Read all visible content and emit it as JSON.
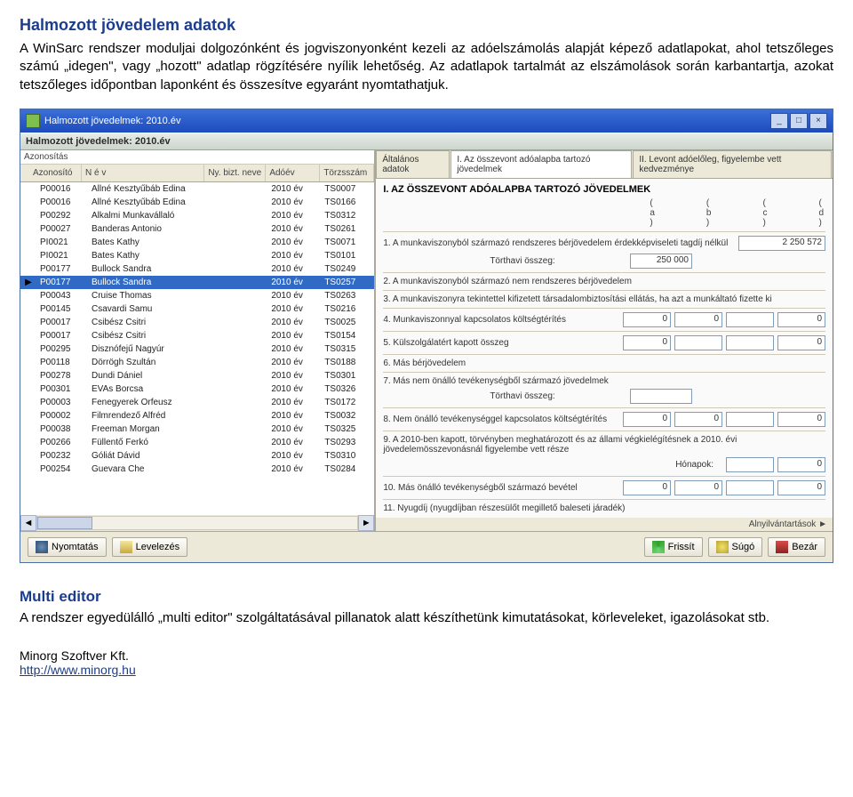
{
  "doc": {
    "heading": "Halmozott jövedelem adatok",
    "para": "A WinSarc rendszer moduljai dolgozónként és jogviszonyonként kezeli az adóelszámolás alapját képező adatlapokat, ahol tetszőleges számú „idegen\", vagy „hozott\" adatlap rögzítésére nyílik lehetőség. Az adatlapok tartalmát az elszámolások során karbantartja, azokat tetszőleges időpontban laponként és összesítve egyaránt nyomtathatjuk.",
    "sub": "Multi editor",
    "subpara": "A rendszer egyedülálló „multi editor\" szolgáltatásával pillanatok alatt készíthetünk kimutatásokat, körleveleket, igazolásokat stb.",
    "company": "Minorg Szoftver Kft.",
    "link": "http://www.minorg.hu"
  },
  "win": {
    "title": "Halmozott jövedelmek: 2010.év",
    "subtitle": "Halmozott jövedelmek: 2010.év"
  },
  "grid": {
    "h_id": "Azonosító",
    "h_name": "N é v",
    "h_biz": "Ny. bizt. neve",
    "h_year": "Adóév",
    "h_ts": "Törzsszám",
    "rows": [
      {
        "id": "P00016",
        "name": "Allné Kesztyűbáb Edina",
        "year": "2010 év",
        "ts": "TS0007"
      },
      {
        "id": "P00016",
        "name": "Allné Kesztyűbáb Edina",
        "year": "2010 év",
        "ts": "TS0166"
      },
      {
        "id": "P00292",
        "name": "Alkalmi Munkavállaló",
        "year": "2010 év",
        "ts": "TS0312"
      },
      {
        "id": "P00027",
        "name": "Banderas Antonio",
        "year": "2010 év",
        "ts": "TS0261"
      },
      {
        "id": "PI0021",
        "name": "Bates Kathy",
        "year": "2010 év",
        "ts": "TS0071"
      },
      {
        "id": "PI0021",
        "name": "Bates Kathy",
        "year": "2010 év",
        "ts": "TS0101"
      },
      {
        "id": "P00177",
        "name": "Bullock Sandra",
        "year": "2010 év",
        "ts": "TS0249"
      },
      {
        "id": "P00177",
        "name": "Bullock Sandra",
        "year": "2010 év",
        "ts": "TS0257",
        "sel": true
      },
      {
        "id": "P00043",
        "name": "Cruise Thomas",
        "year": "2010 év",
        "ts": "TS0263"
      },
      {
        "id": "P00145",
        "name": "Csavardi Samu",
        "year": "2010 év",
        "ts": "TS0216"
      },
      {
        "id": "P00017",
        "name": "Csibész Csitri",
        "year": "2010 év",
        "ts": "TS0025"
      },
      {
        "id": "P00017",
        "name": "Csibész Csitri",
        "year": "2010 év",
        "ts": "TS0154"
      },
      {
        "id": "P00295",
        "name": "Disznófejű Nagyúr",
        "year": "2010 év",
        "ts": "TS0315"
      },
      {
        "id": "P00118",
        "name": "Dörrögh Szultán",
        "year": "2010 év",
        "ts": "TS0188"
      },
      {
        "id": "P00278",
        "name": "Dundi Dániel",
        "year": "2010 év",
        "ts": "TS0301"
      },
      {
        "id": "P00301",
        "name": "EVAs  Borcsa",
        "year": "2010 év",
        "ts": "TS0326"
      },
      {
        "id": "P00003",
        "name": "Fenegyerek Orfeusz",
        "year": "2010 év",
        "ts": "TS0172"
      },
      {
        "id": "P00002",
        "name": "Filmrendező Alfréd",
        "year": "2010 év",
        "ts": "TS0032"
      },
      {
        "id": "P00038",
        "name": "Freeman Morgan",
        "year": "2010 év",
        "ts": "TS0325"
      },
      {
        "id": "P00266",
        "name": "Füllentő Ferkó",
        "year": "2010 év",
        "ts": "TS0293"
      },
      {
        "id": "P00232",
        "name": "Góliát Dávid",
        "year": "2010 év",
        "ts": "TS0310"
      },
      {
        "id": "P00254",
        "name": "Guevara Che",
        "year": "2010 év",
        "ts": "TS0284"
      }
    ]
  },
  "tabs": {
    "t1": "Általános adatok",
    "t2": "I. Az összevont adóalapba tartozó jövedelmek",
    "t3": "II. Levont adóelőleg, figyelembe vett kedvezménye"
  },
  "form": {
    "heading": "I. AZ ÖSSZEVONT ADÓALAPBA TARTOZÓ JÖVEDELMEK",
    "a": "( a )",
    "b": "( b )",
    "c": "( c )",
    "d": "( d )",
    "r1": "1. A munkaviszonyból származó rendszeres bérjövedelem érdekképviseleti tagdíj nélkül",
    "r1v": "2 250 572",
    "r1b": "Törthavi összeg:",
    "r1bv": "250 000",
    "r2": "2. A munkaviszonyból származó nem rendszeres bérjövedelem",
    "r3": "3. A munkaviszonyra tekintettel kifizetett társadalombiztosítási ellátás, ha azt a munkáltató fizette ki",
    "r4": "4. Munkaviszonnyal kapcsolatos költségtérítés",
    "r5": "5. Külszolgálatért kapott összeg",
    "r6": "6. Más bérjövedelem",
    "r7": "7. Más nem önálló tevékenységből származó jövedelmek",
    "r7b": "Törthavi összeg:",
    "r8": "8. Nem önálló tevékenységgel kapcsolatos költségtérítés",
    "r9": "9. A 2010-ben kapott, törvényben meghatározott és az állami végkielégítésnek a 2010. évi jövedelemösszevonásnál figyelembe vett része",
    "r9b": "Hónapok:",
    "r10": "10. Más önálló tevékenységből származó bevétel",
    "r11": "11. Nyugdíj (nyugdíjban részesülőt megillető baleseti járadék)",
    "zero": "0",
    "nyilv": "Alnyilvántartások"
  },
  "buttons": {
    "print": "Nyomtatás",
    "mail": "Levelezés",
    "refresh": "Frissít",
    "help": "Súgó",
    "close": "Bezár"
  },
  "grid_title": "Azonosítás"
}
